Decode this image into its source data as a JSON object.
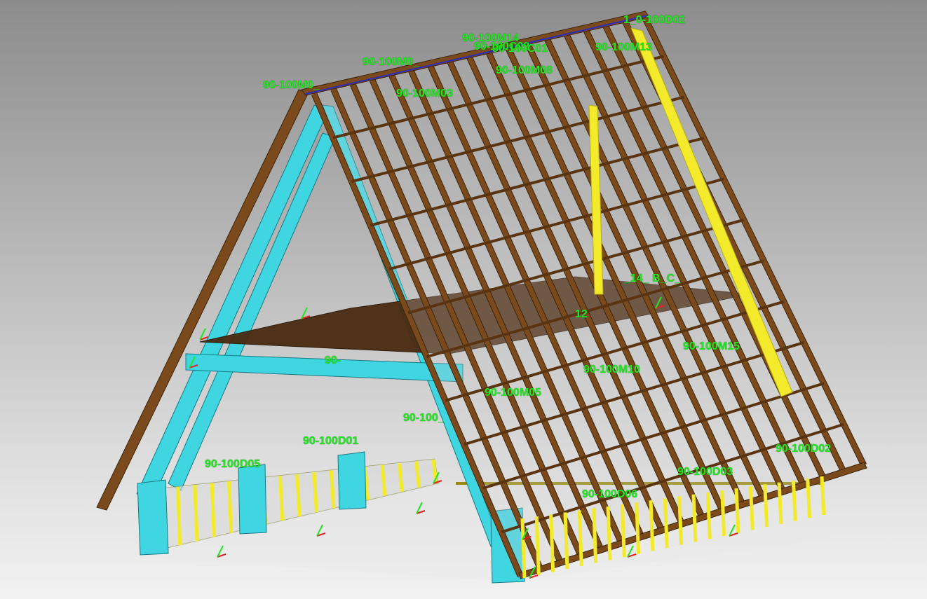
{
  "colors": {
    "background_top": "#8c8c8c",
    "background_bottom": "#f2f2f2",
    "rafter_brown": "#7a4a1c",
    "truss_cyan": "#3fd6e2",
    "stud_yellow": "#f2ea2a",
    "label_green": "#22e622",
    "axis_red": "#e22222",
    "axis_green": "#22e622"
  },
  "component_labels": [
    "1_0-100D02",
    "90-100M14",
    "90-100C02",
    "90-100C01",
    "90-100M13",
    "90-100M0_",
    "90-100M08",
    "90-100M0_",
    "90-100M03",
    "_14_ B_C_",
    "90-100M15",
    "90-",
    "90-100M10",
    "90-100M05",
    "90-100_",
    "90-100D01",
    "90-100D05",
    "90-100D02",
    "90-100D03",
    "90-100D06",
    "12"
  ],
  "icons": {
    "axis_marker": "xyz-axis-icon"
  }
}
